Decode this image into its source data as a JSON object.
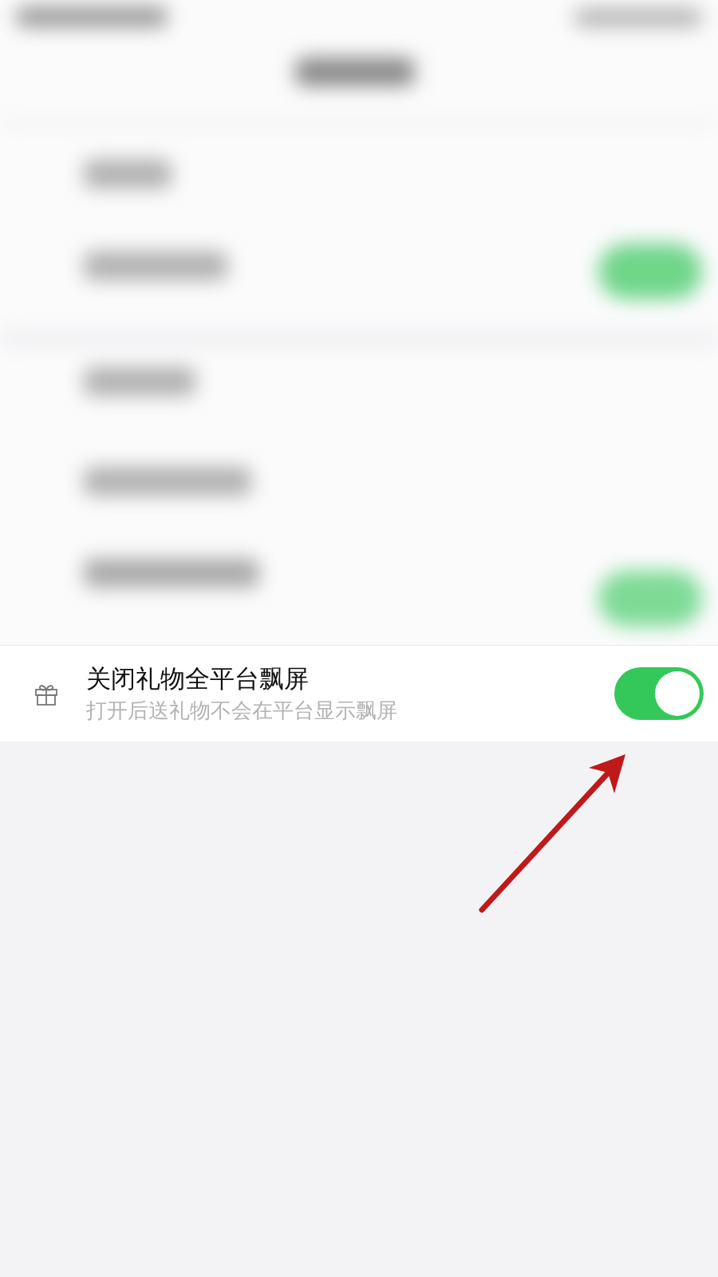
{
  "setting": {
    "title": "关闭礼物全平台飘屏",
    "subtitle": "打开后送礼物不会在平台显示飘屏",
    "on": true
  }
}
